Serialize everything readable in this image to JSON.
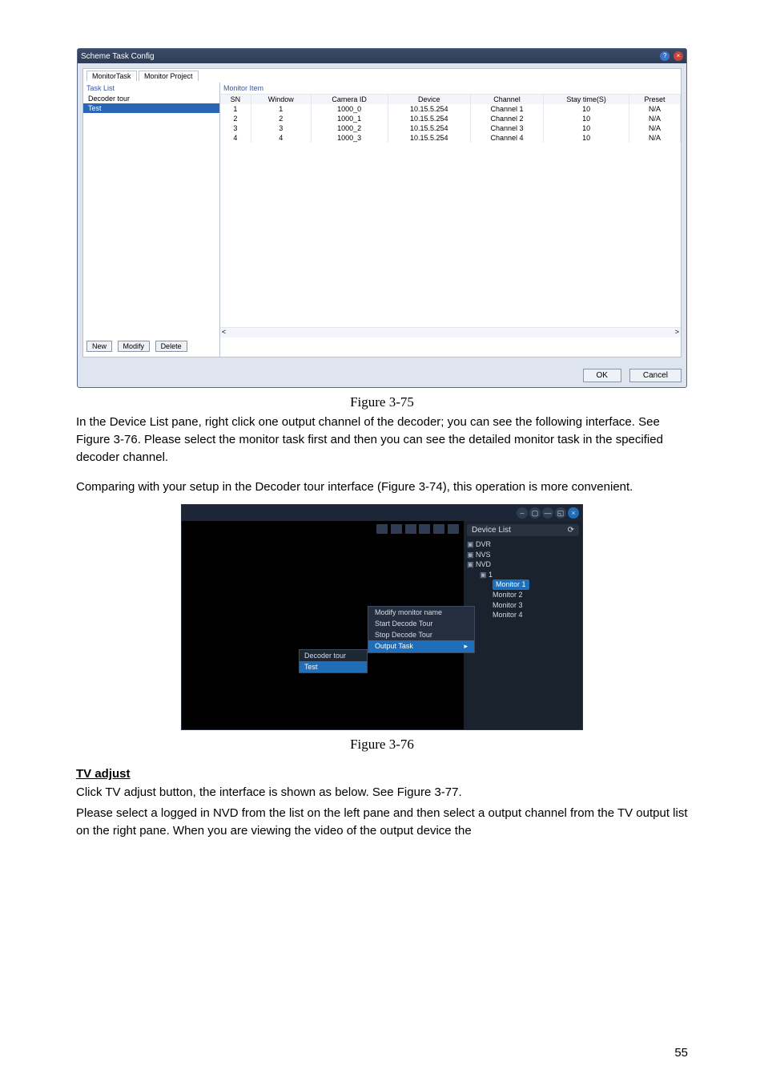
{
  "shot1": {
    "title": "Scheme Task Config",
    "tabs": [
      "MonitorTask",
      "Monitor Project"
    ],
    "taskListHeader": "Task List",
    "monitorHeader": "Monitor Item",
    "taskItems": [
      "Decoder tour",
      "Test"
    ],
    "columns": [
      "SN",
      "Window",
      "Camera ID",
      "Device",
      "Channel",
      "Stay time(S)",
      "Preset"
    ],
    "rows": [
      {
        "sn": "1",
        "window": "1",
        "camera": "1000_0",
        "device": "10.15.5.254",
        "channel": "Channel 1",
        "stay": "10",
        "preset": "N/A"
      },
      {
        "sn": "2",
        "window": "2",
        "camera": "1000_1",
        "device": "10.15.5.254",
        "channel": "Channel 2",
        "stay": "10",
        "preset": "N/A"
      },
      {
        "sn": "3",
        "window": "3",
        "camera": "1000_2",
        "device": "10.15.5.254",
        "channel": "Channel 3",
        "stay": "10",
        "preset": "N/A"
      },
      {
        "sn": "4",
        "window": "4",
        "camera": "1000_3",
        "device": "10.15.5.254",
        "channel": "Channel 4",
        "stay": "10",
        "preset": "N/A"
      }
    ],
    "btnNew": "New",
    "btnModify": "Modify",
    "btnDelete": "Delete",
    "btnOK": "OK",
    "btnCancel": "Cancel"
  },
  "caption1": "Figure 3-75",
  "para1": "In the Device List pane, right click one output channel of the decoder; you can see the following interface. See Figure 3-76. Please select the monitor task first and then you can see the detailed monitor task in the specified decoder channel.",
  "para2": "Comparing with your setup in the Decoder tour interface (Figure 3-74), this operation is more convenient.",
  "shot2": {
    "deviceList": "Device List",
    "tree": {
      "dvr": "DVR",
      "nvs": "NVS",
      "nvd": "NVD",
      "nvd1": "1",
      "monitors": [
        "Monitor 1",
        "Monitor 2",
        "Monitor 3",
        "Monitor 4"
      ]
    },
    "ctx": {
      "modify": "Modify monitor name",
      "start": "Start Decode Tour",
      "stop": "Stop Decode Tour",
      "output": "Output Task"
    },
    "submenu": {
      "header": "Decoder tour",
      "item": "Test"
    }
  },
  "caption2": "Figure 3-76",
  "heading": "TV adjust",
  "para3": "Click TV adjust button, the interface is shown as below. See Figure 3-77.",
  "para4": "Please select a logged in NVD from the list on the left pane and then select a output channel from the TV output list on the right pane. When you are viewing the video of the output device the",
  "pageNum": "55"
}
